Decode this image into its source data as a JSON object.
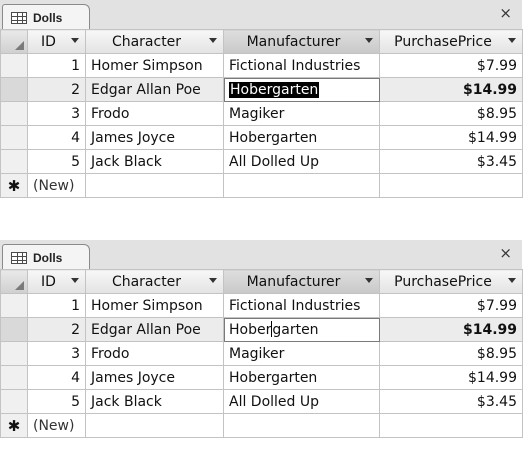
{
  "sheets": [
    {
      "tab_title": "Dolls",
      "close_glyph": "×",
      "columns": [
        "ID",
        "Character",
        "Manufacturer",
        "PurchasePrice"
      ],
      "rows": [
        {
          "id": "1",
          "character": "Homer Simpson",
          "manufacturer": "Fictional Industries",
          "price": "$7.99"
        },
        {
          "id": "2",
          "character": "Edgar Allan Poe",
          "manufacturer": "Hobergarten",
          "price": "$14.99"
        },
        {
          "id": "3",
          "character": "Frodo",
          "manufacturer": "Magiker",
          "price": "$8.95"
        },
        {
          "id": "4",
          "character": "James Joyce",
          "manufacturer": "Hobergarten",
          "price": "$14.99"
        },
        {
          "id": "5",
          "character": "Jack Black",
          "manufacturer": "All Dolled Up",
          "price": "$3.45"
        }
      ],
      "new_row_glyph": "✱",
      "new_row_label": "(New)",
      "edit_state": "text fully selected"
    },
    {
      "tab_title": "Dolls",
      "close_glyph": "×",
      "columns": [
        "ID",
        "Character",
        "Manufacturer",
        "PurchasePrice"
      ],
      "rows": [
        {
          "id": "1",
          "character": "Homer Simpson",
          "manufacturer": "Fictional Industries",
          "price": "$7.99"
        },
        {
          "id": "2",
          "character": "Edgar Allan Poe",
          "manufacturer": "Hobergarten",
          "price": "$14.99"
        },
        {
          "id": "3",
          "character": "Frodo",
          "manufacturer": "Magiker",
          "price": "$8.95"
        },
        {
          "id": "4",
          "character": "James Joyce",
          "manufacturer": "Hobergarten",
          "price": "$14.99"
        },
        {
          "id": "5",
          "character": "Jack Black",
          "manufacturer": "All Dolled Up",
          "price": "$3.45"
        }
      ],
      "edit_text_before_caret": "Hober",
      "edit_text_after_caret": "garten",
      "new_row_glyph": "✱",
      "new_row_label": "(New)",
      "edit_state": "caret in text"
    }
  ]
}
